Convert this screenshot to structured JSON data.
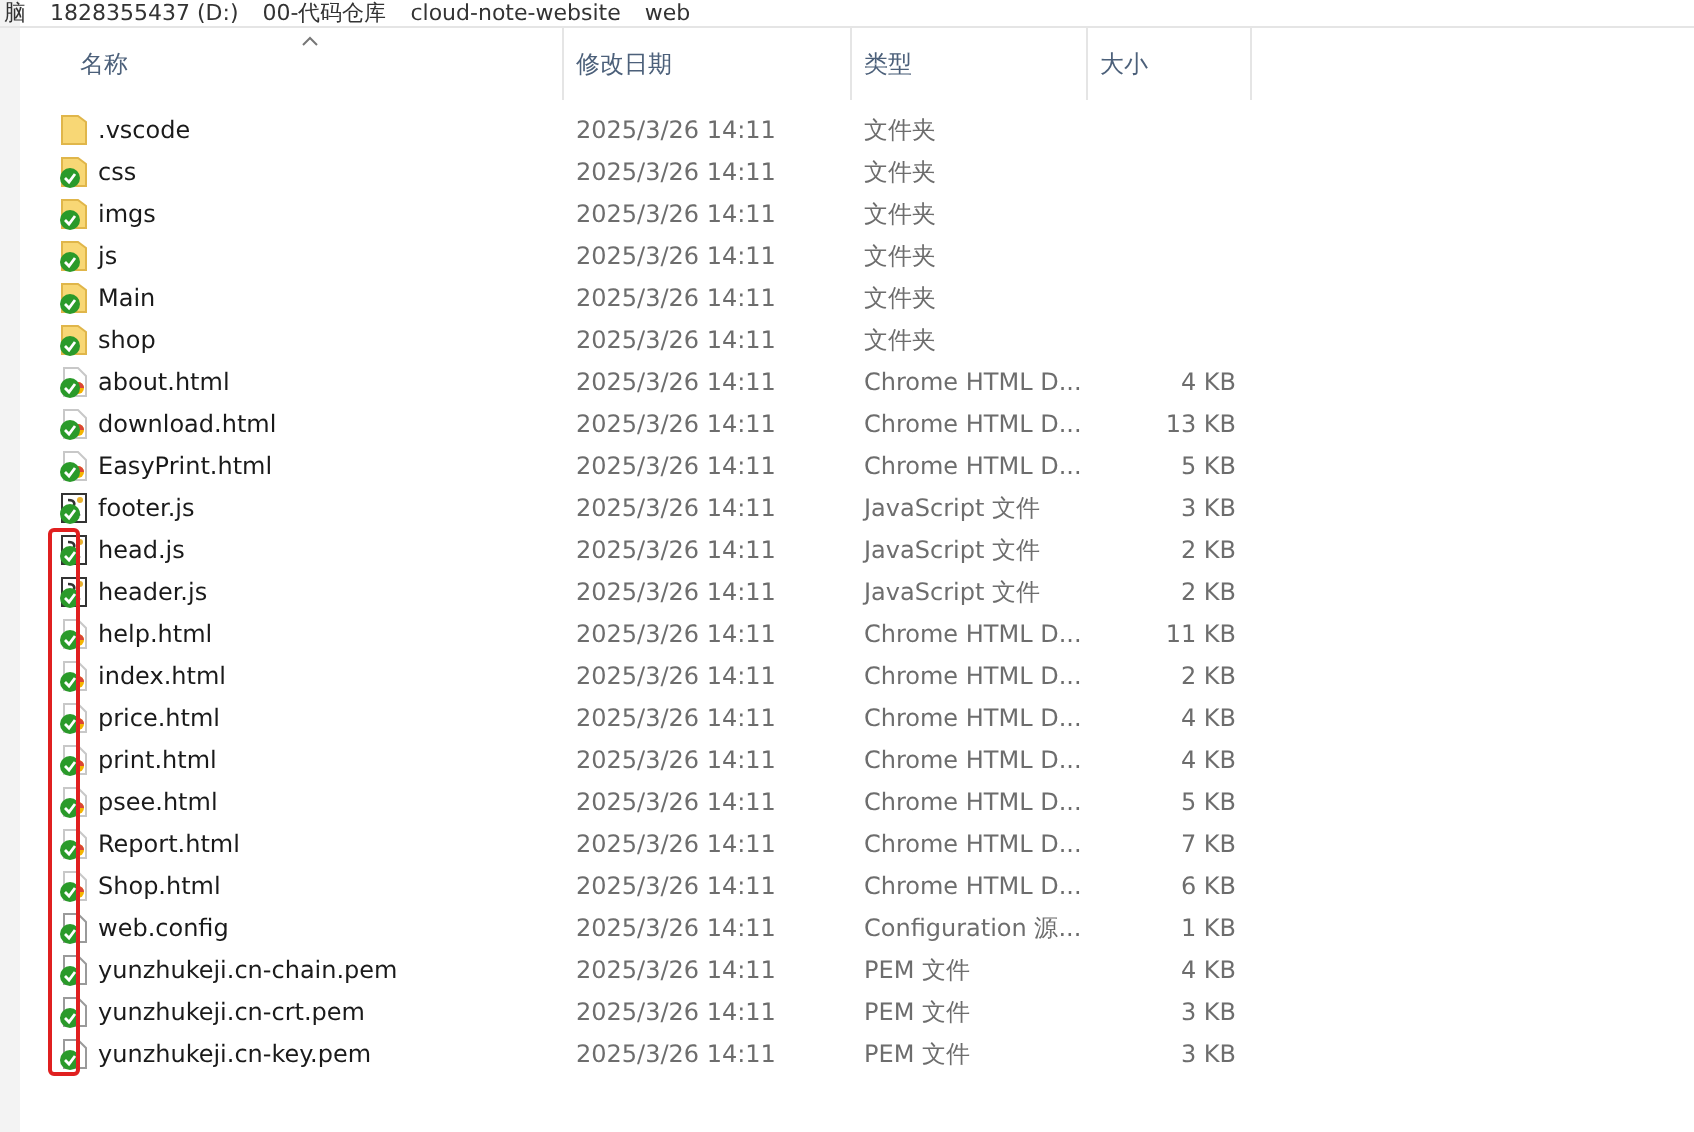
{
  "breadcrumb": [
    "脑",
    "1828355437 (D:)",
    "00-代码仓库",
    "cloud-note-website",
    "web"
  ],
  "columns": [
    {
      "label": "名称",
      "sorted": true
    },
    {
      "label": "修改日期",
      "sorted": false
    },
    {
      "label": "类型",
      "sorted": false
    },
    {
      "label": "大小",
      "sorted": false
    }
  ],
  "files": [
    {
      "name": ".vscode",
      "kind": "folder",
      "synced": false,
      "date": "2025/3/26 14:11",
      "type": "文件夹"
    },
    {
      "name": "css",
      "kind": "folder",
      "synced": true,
      "date": "2025/3/26 14:11",
      "type": "文件夹"
    },
    {
      "name": "imgs",
      "kind": "folder",
      "synced": true,
      "date": "2025/3/26 14:11",
      "type": "文件夹"
    },
    {
      "name": "js",
      "kind": "folder",
      "synced": true,
      "date": "2025/3/26 14:11",
      "type": "文件夹"
    },
    {
      "name": "Main",
      "kind": "folder",
      "synced": true,
      "date": "2025/3/26 14:11",
      "type": "文件夹"
    },
    {
      "name": "shop",
      "kind": "folder",
      "synced": true,
      "date": "2025/3/26 14:11",
      "type": "文件夹"
    },
    {
      "name": "about.html",
      "kind": "html",
      "synced": true,
      "date": "2025/3/26 14:11",
      "type": "Chrome HTML D...",
      "size": "4 KB"
    },
    {
      "name": "download.html",
      "kind": "html",
      "synced": true,
      "date": "2025/3/26 14:11",
      "type": "Chrome HTML D...",
      "size": "13 KB"
    },
    {
      "name": "EasyPrint.html",
      "kind": "html",
      "synced": true,
      "date": "2025/3/26 14:11",
      "type": "Chrome HTML D...",
      "size": "5 KB"
    },
    {
      "name": "footer.js",
      "kind": "script",
      "synced": true,
      "date": "2025/3/26 14:11",
      "type": "JavaScript 文件",
      "size": "3 KB"
    },
    {
      "name": "head.js",
      "kind": "script",
      "synced": true,
      "date": "2025/3/26 14:11",
      "type": "JavaScript 文件",
      "size": "2 KB"
    },
    {
      "name": "header.js",
      "kind": "script",
      "synced": true,
      "date": "2025/3/26 14:11",
      "type": "JavaScript 文件",
      "size": "2 KB"
    },
    {
      "name": "help.html",
      "kind": "html",
      "synced": true,
      "date": "2025/3/26 14:11",
      "type": "Chrome HTML D...",
      "size": "11 KB"
    },
    {
      "name": "index.html",
      "kind": "html",
      "synced": true,
      "date": "2025/3/26 14:11",
      "type": "Chrome HTML D...",
      "size": "2 KB"
    },
    {
      "name": "price.html",
      "kind": "html",
      "synced": true,
      "date": "2025/3/26 14:11",
      "type": "Chrome HTML D...",
      "size": "4 KB"
    },
    {
      "name": "print.html",
      "kind": "html",
      "synced": true,
      "date": "2025/3/26 14:11",
      "type": "Chrome HTML D...",
      "size": "4 KB"
    },
    {
      "name": "psee.html",
      "kind": "html",
      "synced": true,
      "date": "2025/3/26 14:11",
      "type": "Chrome HTML D...",
      "size": "5 KB"
    },
    {
      "name": "Report.html",
      "kind": "html",
      "synced": true,
      "date": "2025/3/26 14:11",
      "type": "Chrome HTML D...",
      "size": "7 KB"
    },
    {
      "name": "Shop.html",
      "kind": "html",
      "synced": true,
      "date": "2025/3/26 14:11",
      "type": "Chrome HTML D...",
      "size": "6 KB"
    },
    {
      "name": "web.config",
      "kind": "file",
      "synced": true,
      "date": "2025/3/26 14:11",
      "type": "Configuration 源...",
      "size": "1 KB"
    },
    {
      "name": "yunzhukeji.cn-chain.pem",
      "kind": "file",
      "synced": true,
      "date": "2025/3/26 14:11",
      "type": "PEM 文件",
      "size": "4 KB"
    },
    {
      "name": "yunzhukeji.cn-crt.pem",
      "kind": "file",
      "synced": true,
      "date": "2025/3/26 14:11",
      "type": "PEM 文件",
      "size": "3 KB"
    },
    {
      "name": "yunzhukeji.cn-key.pem",
      "kind": "file",
      "synced": true,
      "date": "2025/3/26 14:11",
      "type": "PEM 文件",
      "size": "3 KB"
    }
  ]
}
